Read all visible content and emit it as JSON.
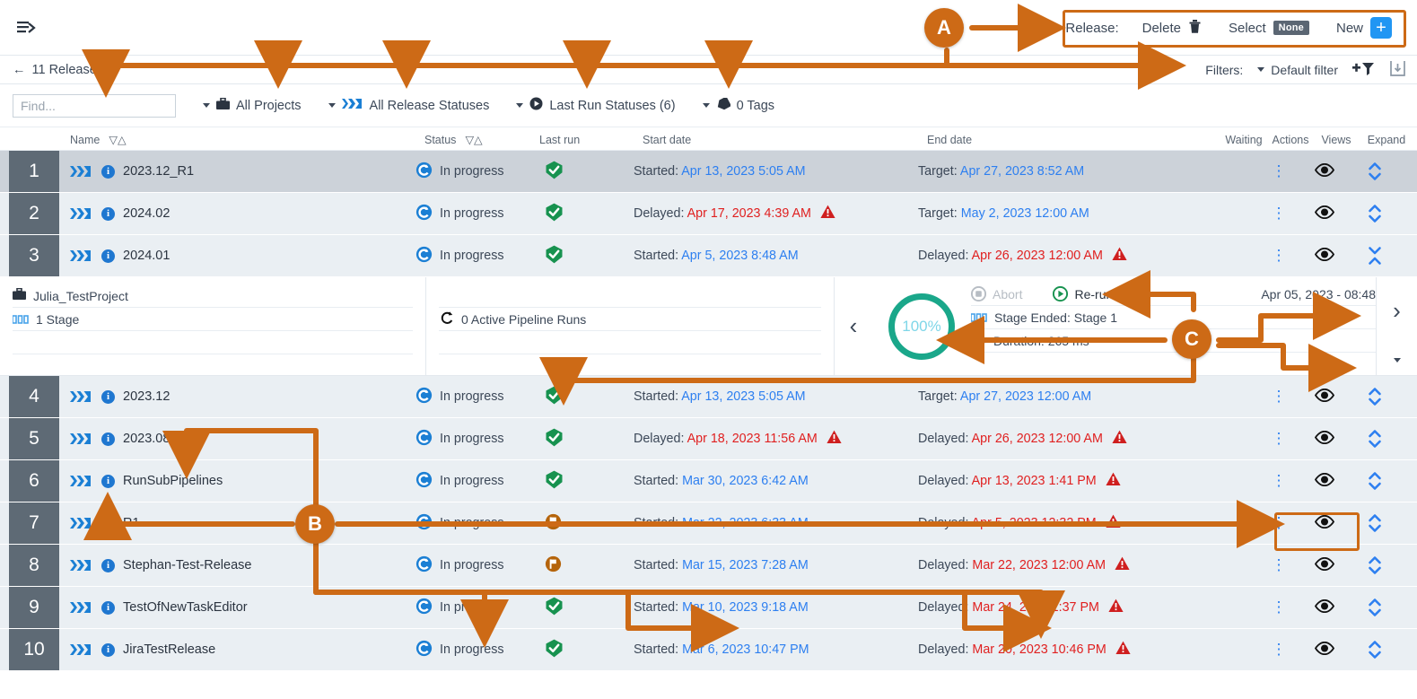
{
  "topbar": {
    "menu_icon": "menu-expand-icon",
    "release_label": "Release:",
    "delete_label": "Delete",
    "delete_icon": "trash-icon",
    "select_label": "Select",
    "select_value": "None",
    "new_label": "New",
    "new_icon": "plus-square-icon"
  },
  "filterbar": {
    "back_label": "11 Releases",
    "back_icon": "arrow-left-icon",
    "filters_label": "Filters:",
    "default_filter": "Default filter",
    "add_filter_icon": "add-filter-icon",
    "save_filter_icon": "save-filter-icon"
  },
  "searchrow": {
    "find_placeholder": "Find...",
    "find_value": "",
    "projects": "All Projects",
    "release_statuses": "All Release Statuses",
    "last_run_statuses": "Last Run Statuses (6)",
    "tags": "0 Tags"
  },
  "table": {
    "headers": {
      "name": "Name",
      "status": "Status",
      "last_run": "Last run",
      "start_date": "Start date",
      "end_date": "End date",
      "waiting": "Waiting",
      "actions": "Actions",
      "views": "Views",
      "expand": "Expand"
    },
    "rows": [
      {
        "num": "1",
        "name": "2023.12_R1",
        "status": "In progress",
        "last_run_icon": "check-circle-green",
        "start_label": "Started:",
        "start_value": "Apr 13, 2023 5:05 AM",
        "start_state": "ok",
        "start_warn": false,
        "end_label": "Target:",
        "end_value": "Apr 27, 2023 8:52 AM",
        "end_state": "ok",
        "end_warn": false,
        "selected": true
      },
      {
        "num": "2",
        "name": "2024.02",
        "status": "In progress",
        "last_run_icon": "check-circle-green",
        "start_label": "Delayed:",
        "start_value": "Apr 17, 2023 4:39 AM",
        "start_state": "late",
        "start_warn": true,
        "end_label": "Target:",
        "end_value": "May 2, 2023 12:00 AM",
        "end_state": "ok",
        "end_warn": false,
        "selected": false
      },
      {
        "num": "3",
        "name": "2024.01",
        "status": "In progress",
        "last_run_icon": "check-circle-green",
        "start_label": "Started:",
        "start_value": "Apr 5, 2023 8:48 AM",
        "start_state": "ok",
        "start_warn": false,
        "end_label": "Delayed:",
        "end_value": "Apr 26, 2023 12:00 AM",
        "end_state": "late",
        "end_warn": true,
        "selected": false,
        "expanded": true
      },
      {
        "num": "4",
        "name": "2023.12",
        "status": "In progress",
        "last_run_icon": "check-circle-green",
        "start_label": "Started:",
        "start_value": "Apr 13, 2023 5:05 AM",
        "start_state": "ok",
        "start_warn": false,
        "end_label": "Target:",
        "end_value": "Apr 27, 2023 12:00 AM",
        "end_state": "ok",
        "end_warn": false,
        "selected": false
      },
      {
        "num": "5",
        "name": "2023.08",
        "status": "In progress",
        "last_run_icon": "check-circle-green",
        "start_label": "Delayed:",
        "start_value": "Apr 18, 2023 11:56 AM",
        "start_state": "late",
        "start_warn": true,
        "end_label": "Delayed:",
        "end_value": "Apr 26, 2023 12:00 AM",
        "end_state": "late",
        "end_warn": true,
        "selected": false
      },
      {
        "num": "6",
        "name": "RunSubPipelines",
        "status": "In progress",
        "last_run_icon": "check-circle-green",
        "start_label": "Started:",
        "start_value": "Mar 30, 2023 6:42 AM",
        "start_state": "ok",
        "start_warn": false,
        "end_label": "Delayed:",
        "end_value": "Apr 13, 2023 1:41 PM",
        "end_state": "late",
        "end_warn": true,
        "selected": false
      },
      {
        "num": "7",
        "name": "R1",
        "status": "In progress",
        "last_run_icon": "flag-circle-orange",
        "start_label": "Started:",
        "start_value": "Mar 22, 2023 6:33 AM",
        "start_state": "ok",
        "start_warn": false,
        "end_label": "Delayed:",
        "end_value": "Apr 5, 2023 12:32 PM",
        "end_state": "late",
        "end_warn": true,
        "selected": false
      },
      {
        "num": "8",
        "name": "Stephan-Test-Release",
        "status": "In progress",
        "last_run_icon": "flag-circle-orange",
        "start_label": "Started:",
        "start_value": "Mar 15, 2023 7:28 AM",
        "start_state": "ok",
        "start_warn": false,
        "end_label": "Delayed:",
        "end_value": "Mar 22, 2023 12:00 AM",
        "end_state": "late",
        "end_warn": true,
        "selected": false
      },
      {
        "num": "9",
        "name": "TestOfNewTaskEditor",
        "status": "In progress",
        "last_run_icon": "check-circle-green",
        "start_label": "Started:",
        "start_value": "Mar 10, 2023 9:18 AM",
        "start_state": "ok",
        "start_warn": false,
        "end_label": "Delayed:",
        "end_value": "Mar 24, 2023 1:37 PM",
        "end_state": "late",
        "end_warn": true,
        "selected": false
      },
      {
        "num": "10",
        "name": "JiraTestRelease",
        "status": "In progress",
        "last_run_icon": "check-circle-green",
        "start_label": "Started:",
        "start_value": "Mar 6, 2023 10:47 PM",
        "start_state": "ok",
        "start_warn": false,
        "end_label": "Delayed:",
        "end_value": "Mar 20, 2023 10:46 PM",
        "end_state": "late",
        "end_warn": true,
        "selected": false
      }
    ]
  },
  "detail": {
    "project": "Julia_TestProject",
    "stages": "1 Stage",
    "active_runs": "0 Active Pipeline Runs",
    "abort": "Abort",
    "rerun": "Re-run",
    "progress": "100",
    "progress_suffix": "%",
    "stage_ended": "Stage Ended: Stage 1",
    "duration": "Duration: 265 ms",
    "timestamp": "Apr 05, 2023 - 08:48",
    "prev_icon": "chevron-left-icon",
    "next_icon": "chevron-right-icon",
    "more_icon": "caret-down-icon"
  },
  "annotations": {
    "a": "A",
    "b": "B",
    "c": "C",
    "accent": "#cd6a16"
  }
}
